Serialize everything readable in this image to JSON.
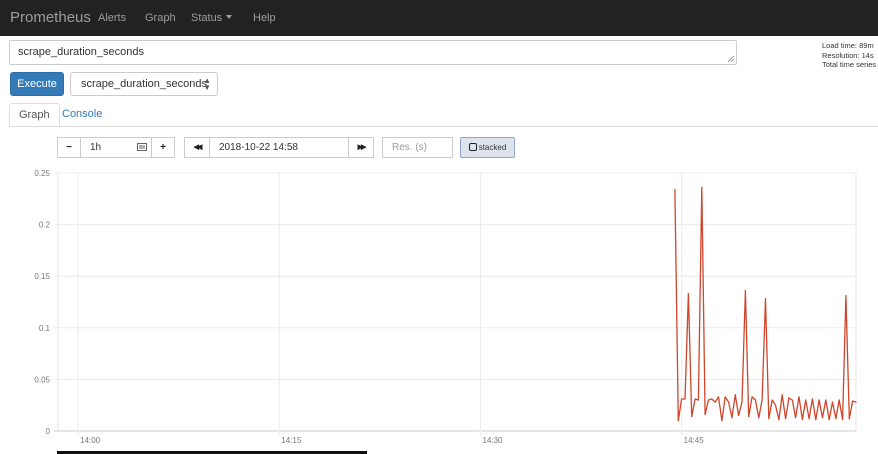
{
  "navbar": {
    "brand": "Prometheus",
    "items": [
      "Alerts",
      "Graph",
      "Status",
      "Help"
    ]
  },
  "query": {
    "expression": "scrape_duration_seconds",
    "execute_label": "Execute",
    "metric_select_value": "scrape_duration_seconds"
  },
  "stats": {
    "load_time": "Load time: 89m",
    "resolution": "Resolution: 14s",
    "total_series": "Total time series"
  },
  "tabs": {
    "graph": "Graph",
    "console": "Console"
  },
  "controls": {
    "minus": "−",
    "range": "1h",
    "plus": "+",
    "back": "◀◀",
    "end_time": "2018-10-22 14:58",
    "forward": "▶▶",
    "resolution_placeholder": "Res. (s)",
    "stacked_label": "stacked"
  },
  "colors": {
    "navbar": "#222222",
    "accent": "#337ab7",
    "series": "#d0452b"
  },
  "chart_data": {
    "type": "line",
    "ylim": [
      0,
      0.25
    ],
    "yticks": [
      "0",
      "0.05",
      "0.1",
      "0.15",
      "0.2",
      "0.25"
    ],
    "xtick_labels": [
      "14:00",
      "14:15",
      "14:30",
      "14:45"
    ],
    "xtick_minutes": [
      0,
      15,
      30,
      45
    ],
    "xlim_minutes": [
      -1.5,
      58
    ],
    "grid": true,
    "series": [
      {
        "minutes": [
          44.5,
          44.75,
          45,
          45.25,
          45.5,
          45.75,
          46,
          46.25,
          46.5,
          46.75,
          47,
          47.25,
          47.5,
          47.75,
          48,
          48.25,
          48.5,
          48.75,
          49,
          49.25,
          49.5,
          49.75,
          50,
          50.25,
          50.5,
          50.75,
          51,
          51.25,
          51.5,
          51.75,
          52,
          52.25,
          52.5,
          52.75,
          53,
          53.25,
          53.5,
          53.75,
          54,
          54.25,
          54.5,
          54.75,
          55,
          55.25,
          55.5,
          55.75,
          56,
          56.25,
          56.5,
          56.75,
          57,
          57.25,
          57.5,
          57.75,
          58
        ],
        "values": [
          0.234,
          0.01,
          0.031,
          0.031,
          0.133,
          0.014,
          0.031,
          0.03,
          0.236,
          0.016,
          0.03,
          0.031,
          0.028,
          0.033,
          0.01,
          0.033,
          0.028,
          0.013,
          0.035,
          0.015,
          0.028,
          0.136,
          0.014,
          0.033,
          0.03,
          0.013,
          0.03,
          0.128,
          0.012,
          0.03,
          0.025,
          0.011,
          0.035,
          0.012,
          0.032,
          0.03,
          0.013,
          0.033,
          0.011,
          0.03,
          0.012,
          0.031,
          0.011,
          0.03,
          0.013,
          0.03,
          0.011,
          0.028,
          0.012,
          0.03,
          0.011,
          0.131,
          0.012,
          0.029,
          0.028
        ]
      }
    ]
  }
}
